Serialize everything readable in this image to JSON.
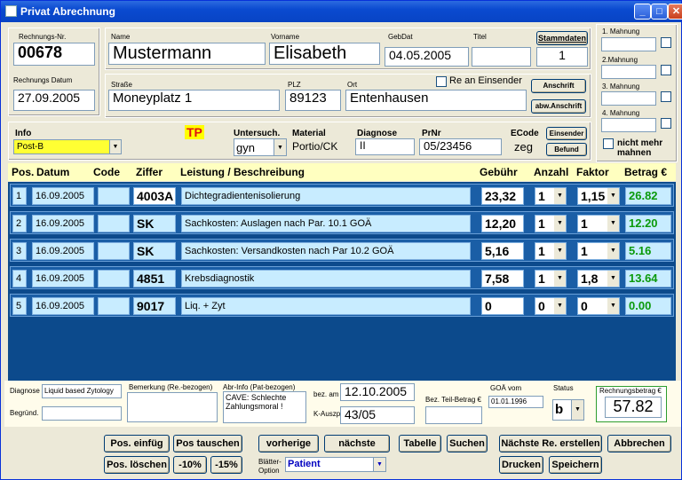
{
  "window": {
    "title": "Privat Abrechnung"
  },
  "invoice": {
    "nr_label": "Rechnungs-Nr.",
    "nr": "00678",
    "date_label": "Rechnungs Datum",
    "date": "27.09.2005"
  },
  "patient": {
    "name_label": "Name",
    "name": "Mustermann",
    "vorname_label": "Vorname",
    "vorname": "Elisabeth",
    "gebdat_label": "GebDat",
    "gebdat": "04.05.2005",
    "titel_label": "Titel",
    "titel": "",
    "stammdaten_label": "Stammdaten",
    "stammdaten": "1",
    "strasse_label": "Straße",
    "strasse": "Moneyplatz 1",
    "plz_label": "PLZ",
    "plz": "89123",
    "ort_label": "Ort",
    "ort": "Entenhausen",
    "re_an_einsender": "Re an Einsender",
    "anschrift_button": "Anschrift",
    "abw_anschrift_button": "abw.Anschrift"
  },
  "mahnung": {
    "m1": "1. Mahnung",
    "m2": "2.Mahnung",
    "m3": "3. Mahnung",
    "m4": "4. Mahnung",
    "nicht_mehr_mahnen": "nicht mehr mahnen"
  },
  "info": {
    "info_label": "Info",
    "info_value": "Post-B",
    "tp": "TP",
    "untersuch_label": "Untersuch.",
    "untersuch_value": "gyn",
    "material_label": "Material",
    "material_value": "Portio/CK",
    "diagnose_label": "Diagnose",
    "diagnose_value": "II",
    "prnr_label": "PrNr",
    "prnr_value": "05/23456",
    "ecode_label": "ECode",
    "ecode_value": "zeg",
    "einsender_button": "Einsender",
    "befund_button": "Befund"
  },
  "table": {
    "headers": {
      "pos": "Pos.",
      "datum": "Datum",
      "code": "Code",
      "ziffer": "Ziffer",
      "leistung": "Leistung / Beschreibung",
      "gebuehr": "Gebühr",
      "anzahl": "Anzahl",
      "faktor": "Faktor",
      "betrag": "Betrag €"
    },
    "rows": [
      {
        "pos": "1",
        "datum": "16.09.2005",
        "code": "",
        "ziffer": "4003A",
        "leistung": "Dichtegradientenisolierung",
        "gebuehr": "23,32",
        "anzahl": "1",
        "faktor": "1,15",
        "betrag": "26.82"
      },
      {
        "pos": "2",
        "datum": "16.09.2005",
        "code": "",
        "ziffer": "SK",
        "leistung": "Sachkosten: Auslagen nach Par. 10.1 GOÄ",
        "gebuehr": "12,20",
        "anzahl": "1",
        "faktor": "1",
        "betrag": "12.20"
      },
      {
        "pos": "3",
        "datum": "16.09.2005",
        "code": "",
        "ziffer": "SK",
        "leistung": "Sachkosten: Versandkosten nach Par 10.2 GOÄ",
        "gebuehr": "5,16",
        "anzahl": "1",
        "faktor": "1",
        "betrag": "5.16"
      },
      {
        "pos": "4",
        "datum": "16.09.2005",
        "code": "",
        "ziffer": "4851",
        "leistung": "Krebsdiagnostik",
        "gebuehr": "7,58",
        "anzahl": "1",
        "faktor": "1,8",
        "betrag": "13.64"
      },
      {
        "pos": "5",
        "datum": "16.09.2005",
        "code": "",
        "ziffer": "9017",
        "leistung": "Liq. + Zyt",
        "gebuehr": "0",
        "anzahl": "0",
        "faktor": "0",
        "betrag": "0.00"
      }
    ]
  },
  "footer": {
    "diagnose_label": "Diagnose",
    "diagnose_value": "Liquid based Zytology",
    "begruend_label": "Begründ.",
    "begruend_value": "",
    "bemerkung_label": "Bemerkung (Re.-bezogen)",
    "abrinfo_label": "Abr-Info (Pat-bezogen)",
    "abrinfo_value": "CAVE: Schlechte Zahlungsmoral !",
    "bez_am_label": "bez. am",
    "bez_am_value": "12.10.2005",
    "kauszp_label": "K-Auszp",
    "kauszp_value": "43/05",
    "teilbetrag_label": "Bez. Teil-Betrag €",
    "teilbetrag_value": "",
    "goae_label": "GOÄ vom",
    "goae_value": "01.01.1996",
    "status_label": "Status",
    "status_value": "b",
    "rechnungsbetrag_label": "Rechnungsbetrag €",
    "rechnungsbetrag_value": "57.82"
  },
  "buttons": {
    "pos_einfueg": "Pos. einfüg",
    "pos_tauschen": "Pos tauschen",
    "vorherige": "vorherige",
    "naechste": "nächste",
    "tabelle": "Tabelle",
    "suchen": "Suchen",
    "naechste_re": "Nächste Re. erstellen",
    "abbrechen": "Abbrechen",
    "pos_loeschen": "Pos. löschen",
    "minus10": "-10%",
    "minus15": "-15%",
    "blaetter_label": "Blätter-Option",
    "blaetter_value": "Patient",
    "drucken": "Drucken",
    "speichern": "Speichern"
  }
}
